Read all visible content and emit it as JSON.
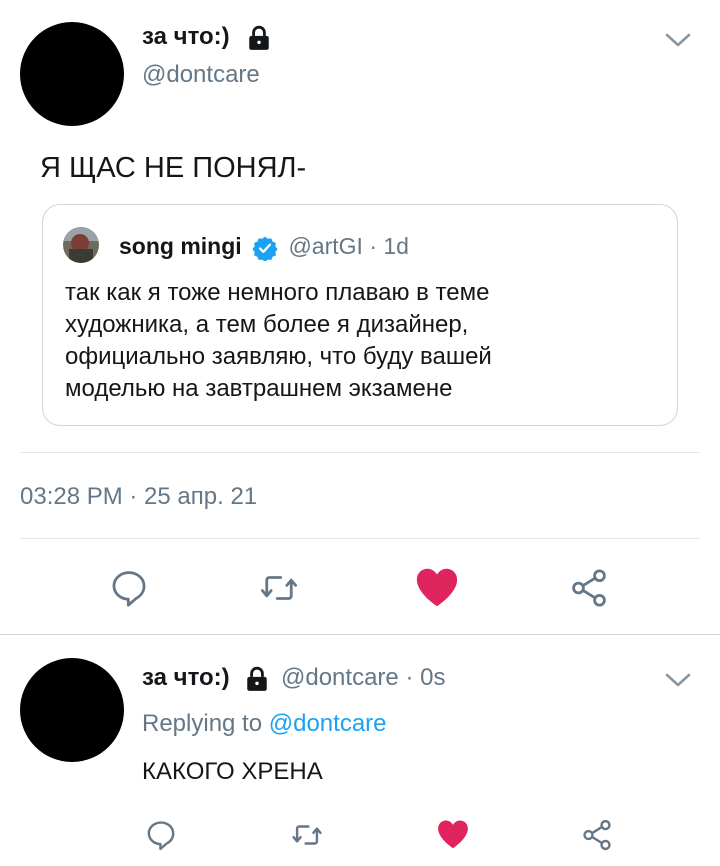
{
  "main_tweet": {
    "display_name": "за что:)",
    "handle": "@dontcare",
    "text": "Я ЩАС НЕ ПОНЯЛ-",
    "timestamp": "03:28 PM · 25 апр. 21",
    "quoted": {
      "display_name": "song mingi",
      "handle": "@artGI",
      "age": "· 1d",
      "lines": [
        "так как я тоже немного плаваю в теме",
        "художника, а тем более я дизайнер,",
        "официально заявляю, что буду вашей",
        "моделью на завтрашнем экзамене"
      ]
    }
  },
  "reply_tweet": {
    "display_name": "за что:)",
    "handle": "@dontcare",
    "age": "· 0s",
    "replying_prefix": "Replying to",
    "replying_handle": "@dontcare",
    "text": "КАКОГО ХРЕНА"
  },
  "icons": {
    "reply": "reply-bubble-icon",
    "retweet": "retweet-icon",
    "like": "heart-icon",
    "share": "share-icon",
    "lock": "lock-icon",
    "verified": "verified-badge-icon",
    "chevron": "chevron-down-icon"
  },
  "colors": {
    "like_red": "#e0245e",
    "icon_gray": "#657786",
    "link_blue": "#1da1f2",
    "verified_blue": "#1da1f2"
  }
}
